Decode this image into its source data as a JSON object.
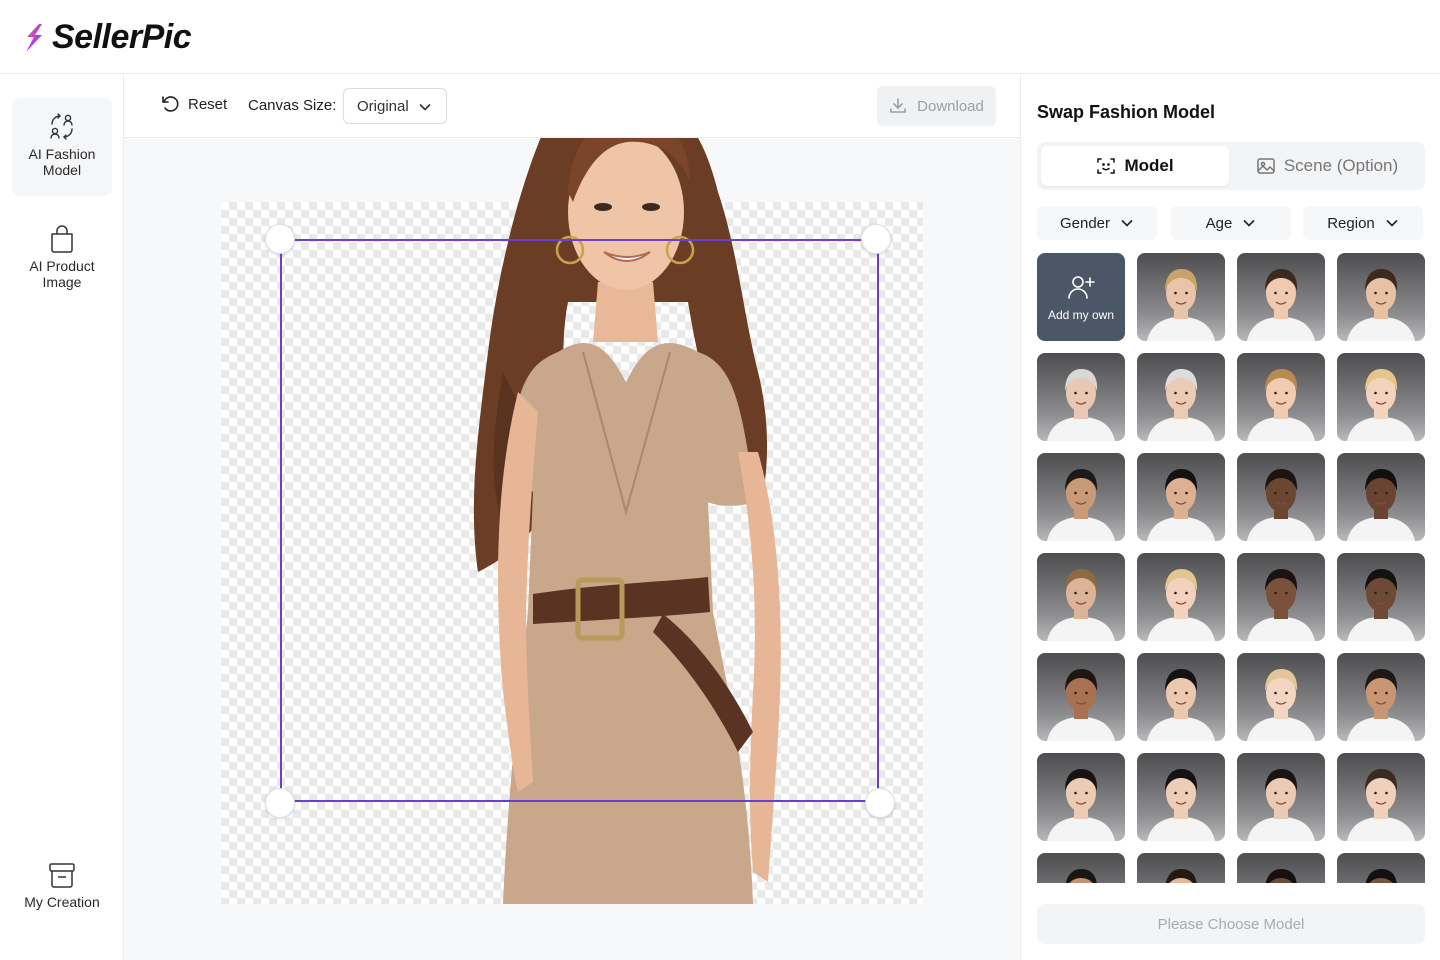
{
  "app": {
    "logo_text": "SellerPic",
    "accent": "#6b3fd1"
  },
  "sidebar": {
    "items": [
      {
        "label": "AI Fashion Model",
        "icon": "fashion-model-icon",
        "active": true
      },
      {
        "label": "AI Product Image",
        "icon": "shopping-bag-icon",
        "active": false
      },
      {
        "label": "My Creation",
        "icon": "archive-box-icon",
        "active": false
      }
    ]
  },
  "toolbar": {
    "reset_label": "Reset",
    "canvas_size_label": "Canvas Size:",
    "canvas_size_value": "Original",
    "download_label": "Download"
  },
  "panel": {
    "title": "Swap Fashion Model",
    "tabs": [
      {
        "label": "Model",
        "icon": "face-scan-icon",
        "active": true
      },
      {
        "label": "Scene (Option)",
        "icon": "image-icon",
        "active": false
      }
    ],
    "filters": [
      {
        "label": "Gender"
      },
      {
        "label": "Age"
      },
      {
        "label": "Region"
      }
    ],
    "add_own_label": "Add my own",
    "models": [
      {
        "skin": "#e9c4a8",
        "hair": "#c9a26a"
      },
      {
        "skin": "#efc9b0",
        "hair": "#3a2a20"
      },
      {
        "skin": "#e8c1a4",
        "hair": "#3b2a1f"
      },
      {
        "skin": "#e8c8b2",
        "hair": "#d8d8d8"
      },
      {
        "skin": "#eccbb6",
        "hair": "#dcdcdc"
      },
      {
        "skin": "#f0cbb0",
        "hair": "#b98a52"
      },
      {
        "skin": "#f3d3bc",
        "hair": "#e6c58a"
      },
      {
        "skin": "#c89a77",
        "hair": "#1e1a18"
      },
      {
        "skin": "#dcb191",
        "hair": "#151212"
      },
      {
        "skin": "#6b4631",
        "hair": "#1b1412"
      },
      {
        "skin": "#6a4432",
        "hair": "#141010"
      },
      {
        "skin": "#dcb396",
        "hair": "#8b6a44"
      },
      {
        "skin": "#f2d2bd",
        "hair": "#e3c58f"
      },
      {
        "skin": "#7a513a",
        "hair": "#1a1311"
      },
      {
        "skin": "#6e4a36",
        "hair": "#151110"
      },
      {
        "skin": "#a87252",
        "hair": "#1e1612"
      },
      {
        "skin": "#ecc8ae",
        "hair": "#141212"
      },
      {
        "skin": "#f3d6c2",
        "hair": "#e2c69a"
      },
      {
        "skin": "#c89673",
        "hair": "#1e1816"
      },
      {
        "skin": "#eccbb4",
        "hair": "#151313"
      },
      {
        "skin": "#eecdb8",
        "hair": "#141212"
      },
      {
        "skin": "#ecc9b2",
        "hair": "#181414"
      },
      {
        "skin": "#f0cfbb",
        "hair": "#3a2a22"
      },
      {
        "skin": "#c49272",
        "hair": "#1b1512"
      },
      {
        "skin": "#e2b898",
        "hair": "#231a15"
      },
      {
        "skin": "#6e4a36",
        "hair": "#141110"
      },
      {
        "skin": "#7a533c",
        "hair": "#121010"
      }
    ],
    "choose_label": "Please Choose Model"
  }
}
